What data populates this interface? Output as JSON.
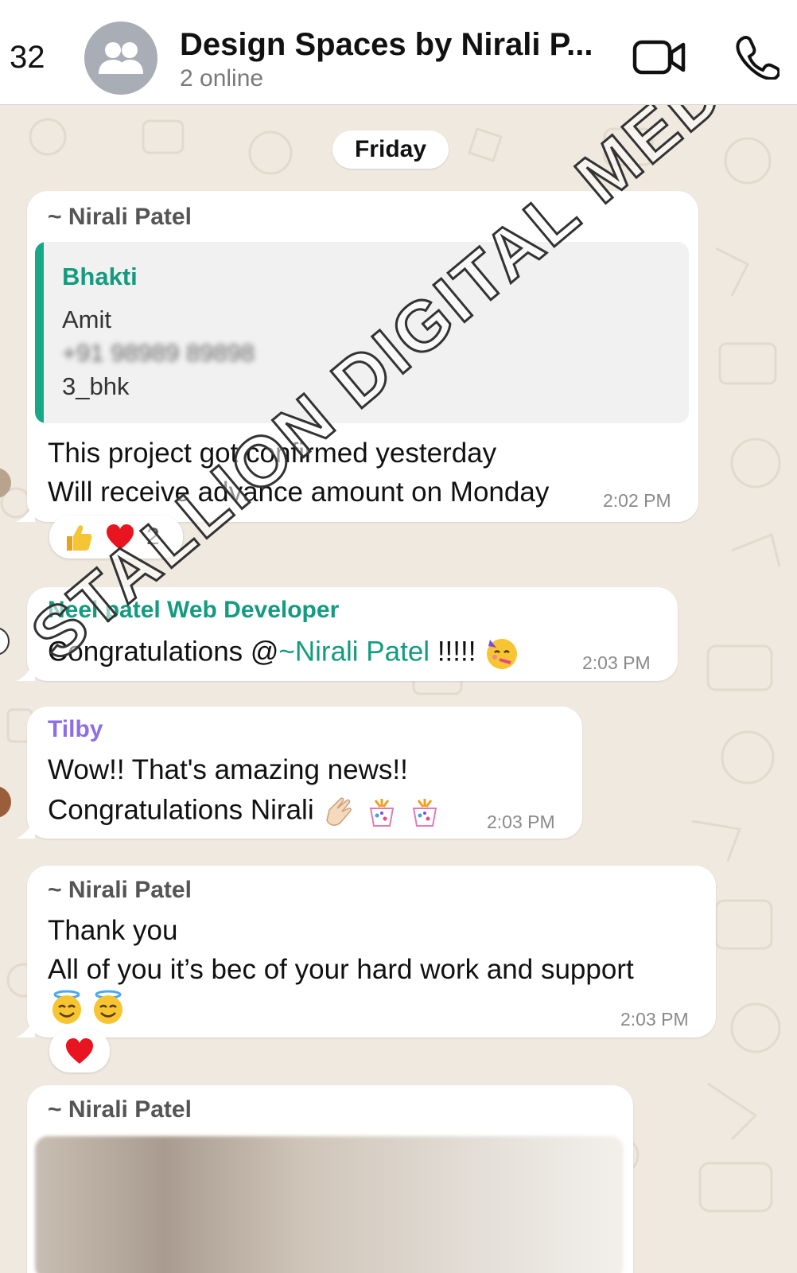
{
  "header": {
    "back_count": "32",
    "title": "Design Spaces by Nirali P...",
    "subtitle": "2 online",
    "video_icon": "video-camera-icon",
    "call_icon": "phone-icon"
  },
  "chat": {
    "day_separator": "Friday",
    "messages": [
      {
        "sender": "~ Nirali Patel",
        "quote": {
          "sender": "Bhakti",
          "lines": [
            "Amit",
            "+91 98989 89898",
            "3_bhk"
          ]
        },
        "lines": [
          "This project got confirmed yesterday",
          "Will receive advance amount on Monday"
        ],
        "time": "2:02 PM",
        "reactions": {
          "count": "2"
        }
      },
      {
        "sender": "Neel patel Web Developer",
        "line_prefix": "Congratulations @",
        "mention": "~Nirali Patel",
        "line_suffix": " !!!!!",
        "time": "2:03 PM"
      },
      {
        "sender": "Tilby",
        "lines": [
          "Wow!! That's amazing news!!",
          "Congratulations Nirali"
        ],
        "time": "2:03 PM"
      },
      {
        "sender": "~ Nirali Patel",
        "lines": [
          "Thank you",
          "All of you it’s bec of your hard work and support"
        ],
        "time": "2:03 PM"
      },
      {
        "sender": "~ Nirali Patel"
      }
    ]
  },
  "watermark": "STALLION DIGITAL MEDIA",
  "colors": {
    "accent_green": "#149b7f",
    "tilby_purple": "#8d6ee6",
    "background": "#efe9df"
  }
}
